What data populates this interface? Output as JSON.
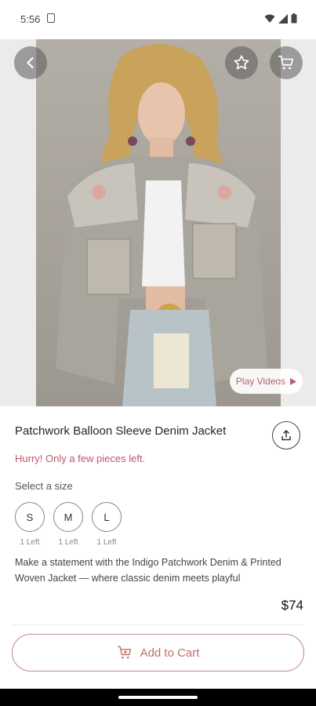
{
  "status_bar": {
    "time": "5:56",
    "icons": [
      "a-notification-icon",
      "wifi-icon",
      "signal-icon",
      "battery-icon"
    ]
  },
  "hero": {
    "image_subject": "model wearing patchwork balloon sleeve denim jacket",
    "carousel": {
      "count": 8,
      "active_index": 1
    },
    "play_videos_label": "Play Videos",
    "icons": [
      "back-arrow-icon",
      "star-icon",
      "cart-icon",
      "play-icon"
    ]
  },
  "product": {
    "title": "Patchwork Balloon Sleeve Denim Jacket",
    "urgency": "Hurry! Only a few pieces left.",
    "size_heading": "Select a size",
    "sizes": [
      {
        "label": "S",
        "stock": "1 Left"
      },
      {
        "label": "M",
        "stock": "1 Left"
      },
      {
        "label": "L",
        "stock": "1 Left"
      }
    ],
    "description": "Make a statement with the Indigo Patchwork Denim & Printed Woven Jacket — where classic denim meets playful",
    "price": "$74"
  },
  "cta": {
    "add_to_cart_label": "Add to Cart"
  },
  "colors": {
    "accent": "#c0616a",
    "urgency": "#c2566a",
    "background": "#ffffff"
  }
}
